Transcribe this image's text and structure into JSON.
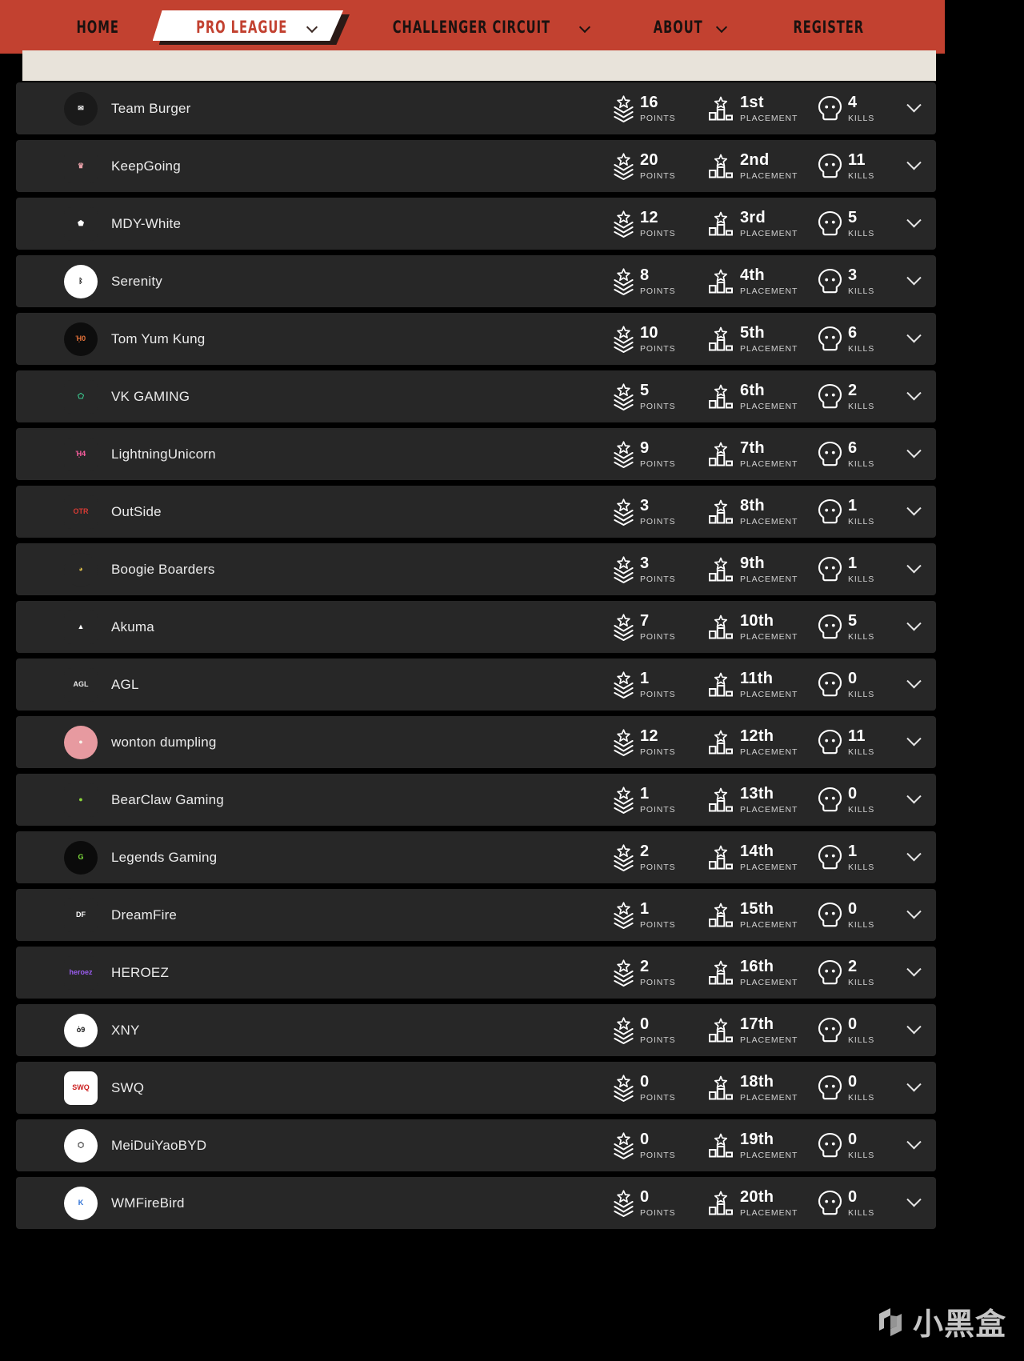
{
  "nav": {
    "items": [
      {
        "label": "HOME",
        "has_caret": false,
        "active": false,
        "icon": ""
      },
      {
        "label": "PRO LEAGUE",
        "has_caret": true,
        "active": true,
        "icon": "chevron-down-icon"
      },
      {
        "label": "CHALLENGER CIRCUIT",
        "has_caret": true,
        "active": false,
        "icon": "chevron-down-icon"
      },
      {
        "label": "ABOUT",
        "has_caret": true,
        "active": false,
        "icon": "chevron-down-icon"
      },
      {
        "label": "REGISTER",
        "has_caret": false,
        "active": false,
        "icon": ""
      }
    ],
    "accent_color": "#c24130",
    "active_tab_color": "#ffffff",
    "subbar_color": "#e8e3da"
  },
  "columns": {
    "points_label": "POINTS",
    "placement_label": "PLACEMENT",
    "kills_label": "KILLS",
    "points_icon": "rank-chevron-star-icon",
    "placement_icon": "podium-star-icon",
    "kills_icon": "skull-icon",
    "expand_icon": "chevron-down-icon"
  },
  "rows": [
    {
      "team": "Team Burger",
      "points": "16",
      "placement": "1st",
      "kills": "4",
      "logo_name": "team-burger-logo",
      "logo_bg": "#1a1a1a",
      "logo_fg": "#ffffff",
      "logo_glyph": "✉",
      "logo_round": true
    },
    {
      "team": "KeepGoing",
      "points": "20",
      "placement": "2nd",
      "kills": "11",
      "logo_name": "keepgoing-logo",
      "logo_bg": "#272727",
      "logo_fg": "#e8a0a8",
      "logo_glyph": "♛",
      "logo_round": false
    },
    {
      "team": "MDY-White",
      "points": "12",
      "placement": "3rd",
      "kills": "5",
      "logo_name": "mdy-white-logo",
      "logo_bg": "#272727",
      "logo_fg": "#ffffff",
      "logo_glyph": "⬟",
      "logo_round": false
    },
    {
      "team": "Serenity",
      "points": "8",
      "placement": "4th",
      "kills": "3",
      "logo_name": "serenity-logo",
      "logo_bg": "#ffffff",
      "logo_fg": "#111111",
      "logo_glyph": "ᛒ",
      "logo_round": true
    },
    {
      "team": "Tom Yum Kung",
      "points": "10",
      "placement": "5th",
      "kills": "6",
      "logo_name": "tom-yum-kung-logo",
      "logo_bg": "#0d0d0d",
      "logo_fg": "#e8743a",
      "logo_glyph": "ᾙ0",
      "logo_round": true
    },
    {
      "team": "VK GAMING",
      "points": "5",
      "placement": "6th",
      "kills": "2",
      "logo_name": "vk-gaming-logo",
      "logo_bg": "#272727",
      "logo_fg": "#3ee2a0",
      "logo_glyph": "⬠",
      "logo_round": false
    },
    {
      "team": "LightningUnicorn",
      "points": "9",
      "placement": "7th",
      "kills": "6",
      "logo_name": "lightningunicorn-logo",
      "logo_bg": "#272727",
      "logo_fg": "#ff5fa2",
      "logo_glyph": "ᾘ4",
      "logo_round": false
    },
    {
      "team": "OutSide",
      "points": "3",
      "placement": "8th",
      "kills": "1",
      "logo_name": "outside-logo",
      "logo_bg": "#272727",
      "logo_fg": "#d93b34",
      "logo_glyph": "OTR",
      "logo_round": false
    },
    {
      "team": "Boogie Boarders",
      "points": "3",
      "placement": "9th",
      "kills": "1",
      "logo_name": "boogie-boarders-logo",
      "logo_bg": "#272727",
      "logo_fg": "#e0c14a",
      "logo_glyph": "◕",
      "logo_round": true
    },
    {
      "team": "Akuma",
      "points": "7",
      "placement": "10th",
      "kills": "5",
      "logo_name": "akuma-logo",
      "logo_bg": "#272727",
      "logo_fg": "#ffffff",
      "logo_glyph": "▲",
      "logo_round": false
    },
    {
      "team": "AGL",
      "points": "1",
      "placement": "11th",
      "kills": "0",
      "logo_name": "agl-logo",
      "logo_bg": "#272727",
      "logo_fg": "#e8e8e8",
      "logo_glyph": "AGL",
      "logo_round": false
    },
    {
      "team": "wonton dumpling",
      "points": "12",
      "placement": "12th",
      "kills": "11",
      "logo_name": "wonton-dumpling-logo",
      "logo_bg": "#e79aa0",
      "logo_fg": "#f7f2ea",
      "logo_glyph": "●",
      "logo_round": true
    },
    {
      "team": "BearClaw Gaming",
      "points": "1",
      "placement": "13th",
      "kills": "0",
      "logo_name": "bearclaw-gaming-logo",
      "logo_bg": "#272727",
      "logo_fg": "#8ad63a",
      "logo_glyph": "●",
      "logo_round": false
    },
    {
      "team": "Legends Gaming",
      "points": "2",
      "placement": "14th",
      "kills": "1",
      "logo_name": "legends-gaming-logo",
      "logo_bg": "#0b0b0b",
      "logo_fg": "#7ede3c",
      "logo_glyph": "G",
      "logo_round": true
    },
    {
      "team": "DreamFire",
      "points": "1",
      "placement": "15th",
      "kills": "0",
      "logo_name": "dreamfire-logo",
      "logo_bg": "#272727",
      "logo_fg": "#ffffff",
      "logo_glyph": "DF",
      "logo_round": false
    },
    {
      "team": "HEROEZ",
      "points": "2",
      "placement": "16th",
      "kills": "2",
      "logo_name": "heroez-logo",
      "logo_bg": "#272727",
      "logo_fg": "#9a5cf0",
      "logo_glyph": "heroez",
      "logo_round": false
    },
    {
      "team": "XNY",
      "points": "0",
      "placement": "17th",
      "kills": "0",
      "logo_name": "xny-logo",
      "logo_bg": "#ffffff",
      "logo_fg": "#141414",
      "logo_glyph": "ὀ9",
      "logo_round": true
    },
    {
      "team": "SWQ",
      "points": "0",
      "placement": "18th",
      "kills": "0",
      "logo_name": "swq-logo",
      "logo_bg": "#ffffff",
      "logo_fg": "#cc2222",
      "logo_glyph": "SWQ",
      "logo_round": false
    },
    {
      "team": "MeiDuiYaoBYD",
      "points": "0",
      "placement": "19th",
      "kills": "0",
      "logo_name": "meiduiyaobyd-logo",
      "logo_bg": "#ffffff",
      "logo_fg": "#111111",
      "logo_glyph": "⬡",
      "logo_round": true
    },
    {
      "team": "WMFireBird",
      "points": "0",
      "placement": "20th",
      "kills": "0",
      "logo_name": "wmfirebird-logo",
      "logo_bg": "#ffffff",
      "logo_fg": "#2a6fd6",
      "logo_glyph": "K",
      "logo_round": true
    }
  ],
  "watermark": {
    "text": "小黑盒",
    "icon": "xiaoheihe-logo-icon"
  }
}
